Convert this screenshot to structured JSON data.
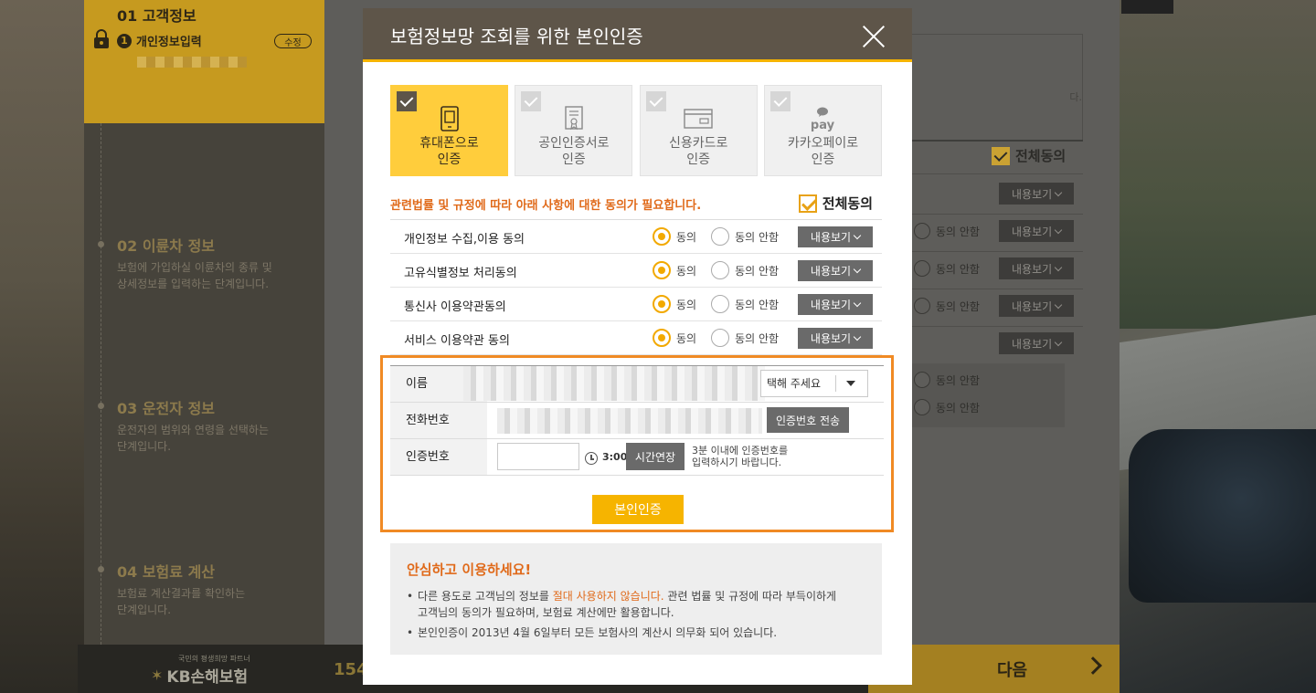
{
  "sidebar": {
    "step1_title": "01 고객정보",
    "sub_step_num": "1",
    "sub_step_label": "개인정보입력",
    "edit_label": "수정",
    "steps": [
      {
        "title": "02 이륜차 정보",
        "desc1": "보험에 가입하실 이륜차의 종류 및",
        "desc2": "상세정보를 입력하는 단계입니다."
      },
      {
        "title": "03 운전자 정보",
        "desc1": "운전자의 범위와 연령을 선택하는",
        "desc2": "단계입니다."
      },
      {
        "title": "04 보험료 계산",
        "desc1": "보험료 계산결과를 확인하는",
        "desc2": "단계입니다."
      }
    ]
  },
  "background": {
    "all_agree": "전체동의",
    "view_label": "내용보기",
    "disagree_label": "동의 안함",
    "panel_text": "다."
  },
  "bottom": {
    "logo_small": "국민의 평생희망 파트너",
    "logo_big": "KB손해보험",
    "number": "154",
    "next_label": "다음"
  },
  "modal": {
    "title": "보험정보망 조회를 위한 본인인증",
    "tabs": [
      {
        "label": "휴대폰으로\n인증",
        "icon": "phone-icon"
      },
      {
        "label": "공인인증서로\n인증",
        "icon": "certificate-icon"
      },
      {
        "label": "신용카드로\n인증",
        "icon": "credit-card-icon"
      },
      {
        "label": "카카오페이로\n인증",
        "icon": "kakaopay-icon"
      }
    ],
    "notice": "관련법률 및 규정에 따라 아래 사항에 대한 동의가 필요합니다.",
    "all_agree": "전체동의",
    "agree_label": "동의",
    "disagree_label": "동의 안함",
    "view_label": "내용보기",
    "consents": [
      {
        "name": "개인정보 수집,이용 동의"
      },
      {
        "name": "고유식별정보 처리동의"
      },
      {
        "name": "통신사 이용약관동의"
      },
      {
        "name": "서비스 이용약관 동의"
      }
    ],
    "auth": {
      "name_label": "이름",
      "carrier_placeholder": "택해 주세요",
      "phone_label": "전화번호",
      "send_button": "인증번호 전송",
      "code_label": "인증번호",
      "timer": "3:00",
      "extend_button": "시간연장",
      "hint_line1": "3분 이내에 인증번호를",
      "hint_line2": "입력하시기 바랍니다.",
      "verify_button": "본인인증"
    },
    "safe": {
      "title": "안심하고 이용하세요!",
      "item1_pre": "다른 용도로 고객님의 정보를 ",
      "item1_em": "절대 사용하지 않습니다.",
      "item1_post": " 관련 법률 및 규정에 따라 부득이하게",
      "item1_line2": "고객님의 동의가 필요하며, 보험료 계산에만 활용합니다.",
      "item2": "본인인증이 2013년 4월 6일부터 모든 보험사의 계산시 의무화 되어 있습니다."
    }
  }
}
